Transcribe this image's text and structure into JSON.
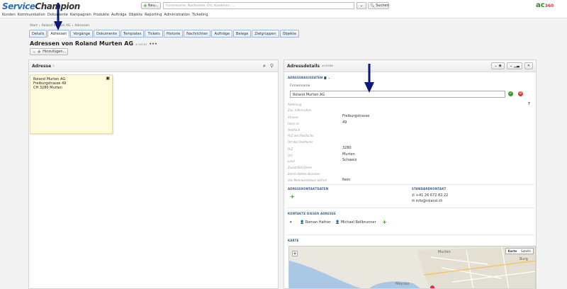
{
  "header": {
    "logo_part1": "Service",
    "logo_part2": "Champion",
    "new_button": "Neu...",
    "search_placeholder": "Firmenname, Nachname, Ort, Kundennr., ...",
    "search_button": "Suchen",
    "brand_right": "ac",
    "brand_right_suffix": "360"
  },
  "menu": [
    "Kunden",
    "Kommunikation",
    "Dokumente",
    "Kampagnen",
    "Produkte",
    "Aufträge",
    "Objekte",
    "Reporting",
    "Administration",
    "Ticketing"
  ],
  "breadcrumb": [
    "Start",
    "Roland Murten AG",
    "Adressen"
  ],
  "tabs": [
    "Details",
    "Adressen",
    "Vorgänge",
    "Dokumente",
    "Templates",
    "Tickets",
    "Historie",
    "Nachrichten",
    "Aufträge",
    "Belege",
    "Zielgruppen",
    "Objekte"
  ],
  "active_tab": "Adressen",
  "page": {
    "title": "Adressen von Roland Murten AG",
    "subtitle": "#746784",
    "add_button": "Hinzufügen..."
  },
  "left_panel": {
    "title": "Adresse",
    "count": "1",
    "card": {
      "line1": "Roland Murten AG",
      "line2": "Freiburgstrasse 49",
      "line3": "CH 3280 Murten"
    }
  },
  "right_panel": {
    "title": "Adressdetails",
    "subtitle": "#149584",
    "section_basis": "ADRESSBASISDATEN",
    "firm_label": "Firmenname",
    "firm_value": "Roland Murten AG",
    "fields": [
      {
        "label": "Abteilung",
        "value": ""
      },
      {
        "label": "Zus. Information",
        "value": ""
      },
      {
        "label": "Strasse",
        "value": "Freiburgstrasse"
      },
      {
        "label": "Haus-nr.",
        "value": "49"
      },
      {
        "label": "Postfach",
        "value": ""
      },
      {
        "label": "PLZ des Postfachs",
        "value": ""
      },
      {
        "label": "Ort des Postfachs",
        "value": ""
      },
      {
        "label": "PLZ",
        "value": "3280"
      },
      {
        "label": "Ort",
        "value": "Murten"
      },
      {
        "label": "Land",
        "value": "Schweiz"
      },
      {
        "label": "Zusatzfeld Eterei",
        "value": ""
      },
      {
        "label": "Eterei-Adress-Nummer",
        "value": ""
      },
      {
        "label": "Von Mehrwertsteuer befreit",
        "value": "Nein"
      }
    ],
    "help_mark": "?",
    "section_kontaktdaten": "ADRESSKONTAKTDATEN",
    "section_standard": "STANDARDKONTAKT",
    "phone": "+41 26 672 82 22",
    "email": "info@roland.ch",
    "section_kontakte": "KONTAKTE DIESER ADRESSE",
    "contacts": [
      "Roman Hafner",
      "Michael Rellbrunner"
    ],
    "section_karte": "KARTE",
    "map_toggle": [
      "Karte",
      "Satellit"
    ],
    "map_labels": [
      "Murten",
      "Burg",
      "Meyriez"
    ]
  }
}
